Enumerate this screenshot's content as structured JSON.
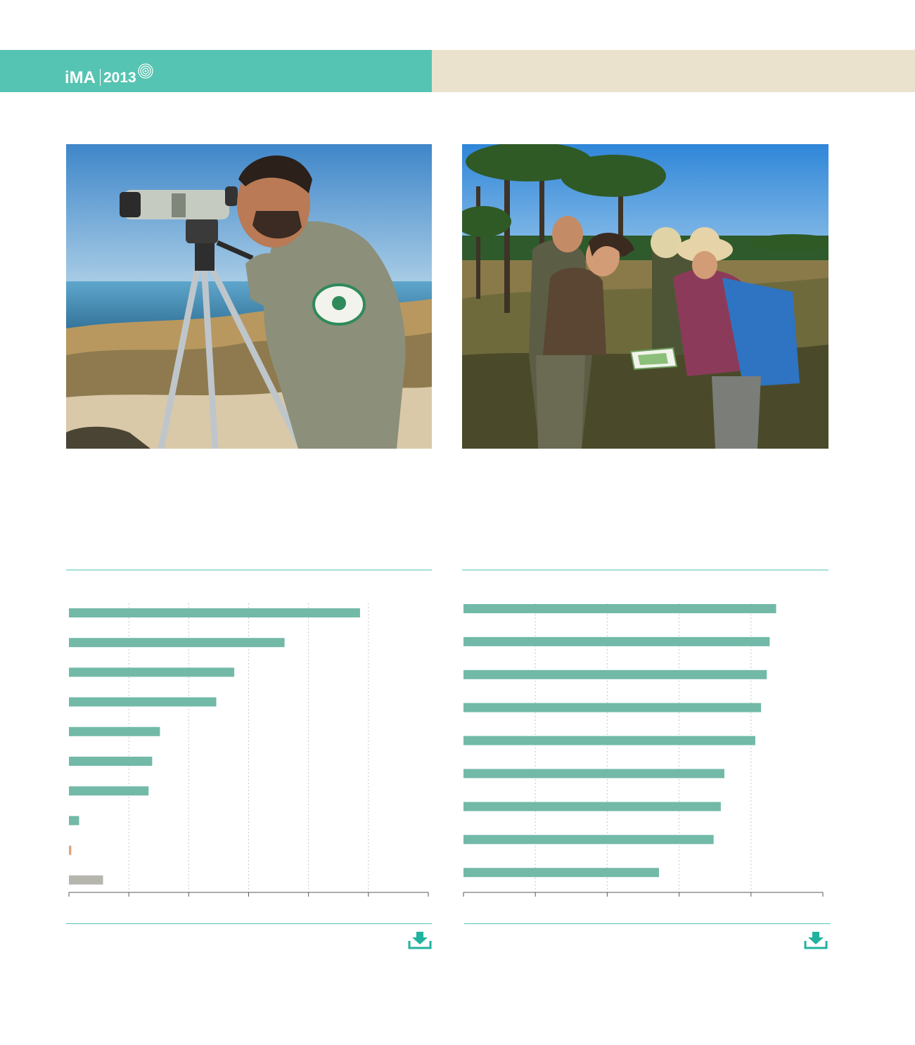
{
  "header": {
    "brand": "iMA",
    "year": "2013",
    "colors": {
      "left_band": "#56c4b2",
      "right_band": "#ebe2cd"
    }
  },
  "photos": [
    {
      "name": "ranger-with-spotting-scope",
      "icon": "photo"
    },
    {
      "name": "field-team-reading-map",
      "icon": "photo"
    }
  ],
  "chart_data": [
    {
      "type": "bar",
      "orientation": "horizontal",
      "x": {
        "min": 0,
        "max": 6,
        "gridlines": [
          1,
          2,
          3,
          4,
          5
        ],
        "grid": true,
        "tick_labels_visible": false
      },
      "bars": [
        {
          "value": 4.86,
          "color": "#72b9a8"
        },
        {
          "value": 3.6,
          "color": "#72b9a8"
        },
        {
          "value": 2.76,
          "color": "#72b9a8"
        },
        {
          "value": 2.46,
          "color": "#72b9a8"
        },
        {
          "value": 1.52,
          "color": "#72b9a8"
        },
        {
          "value": 1.39,
          "color": "#72b9a8"
        },
        {
          "value": 1.33,
          "color": "#72b9a8"
        },
        {
          "value": 0.17,
          "color": "#72b9a8"
        },
        {
          "value": 0.04,
          "color": "#e3a27c"
        },
        {
          "value": 0.57,
          "color": "#b6b6ae"
        }
      ]
    },
    {
      "type": "bar",
      "orientation": "horizontal",
      "x": {
        "min": 0,
        "max": 5,
        "gridlines": [
          1,
          2,
          3,
          4
        ],
        "grid": true,
        "tick_labels_visible": false
      },
      "bars": [
        {
          "value": 4.35,
          "color": "#72b9a8"
        },
        {
          "value": 4.26,
          "color": "#72b9a8"
        },
        {
          "value": 4.22,
          "color": "#72b9a8"
        },
        {
          "value": 4.14,
          "color": "#72b9a8"
        },
        {
          "value": 4.06,
          "color": "#72b9a8"
        },
        {
          "value": 3.63,
          "color": "#72b9a8"
        },
        {
          "value": 3.58,
          "color": "#72b9a8"
        },
        {
          "value": 3.48,
          "color": "#72b9a8"
        },
        {
          "value": 2.72,
          "color": "#72b9a8"
        }
      ]
    }
  ],
  "downloads": [
    {
      "icon": "download-icon"
    },
    {
      "icon": "download-icon"
    }
  ]
}
